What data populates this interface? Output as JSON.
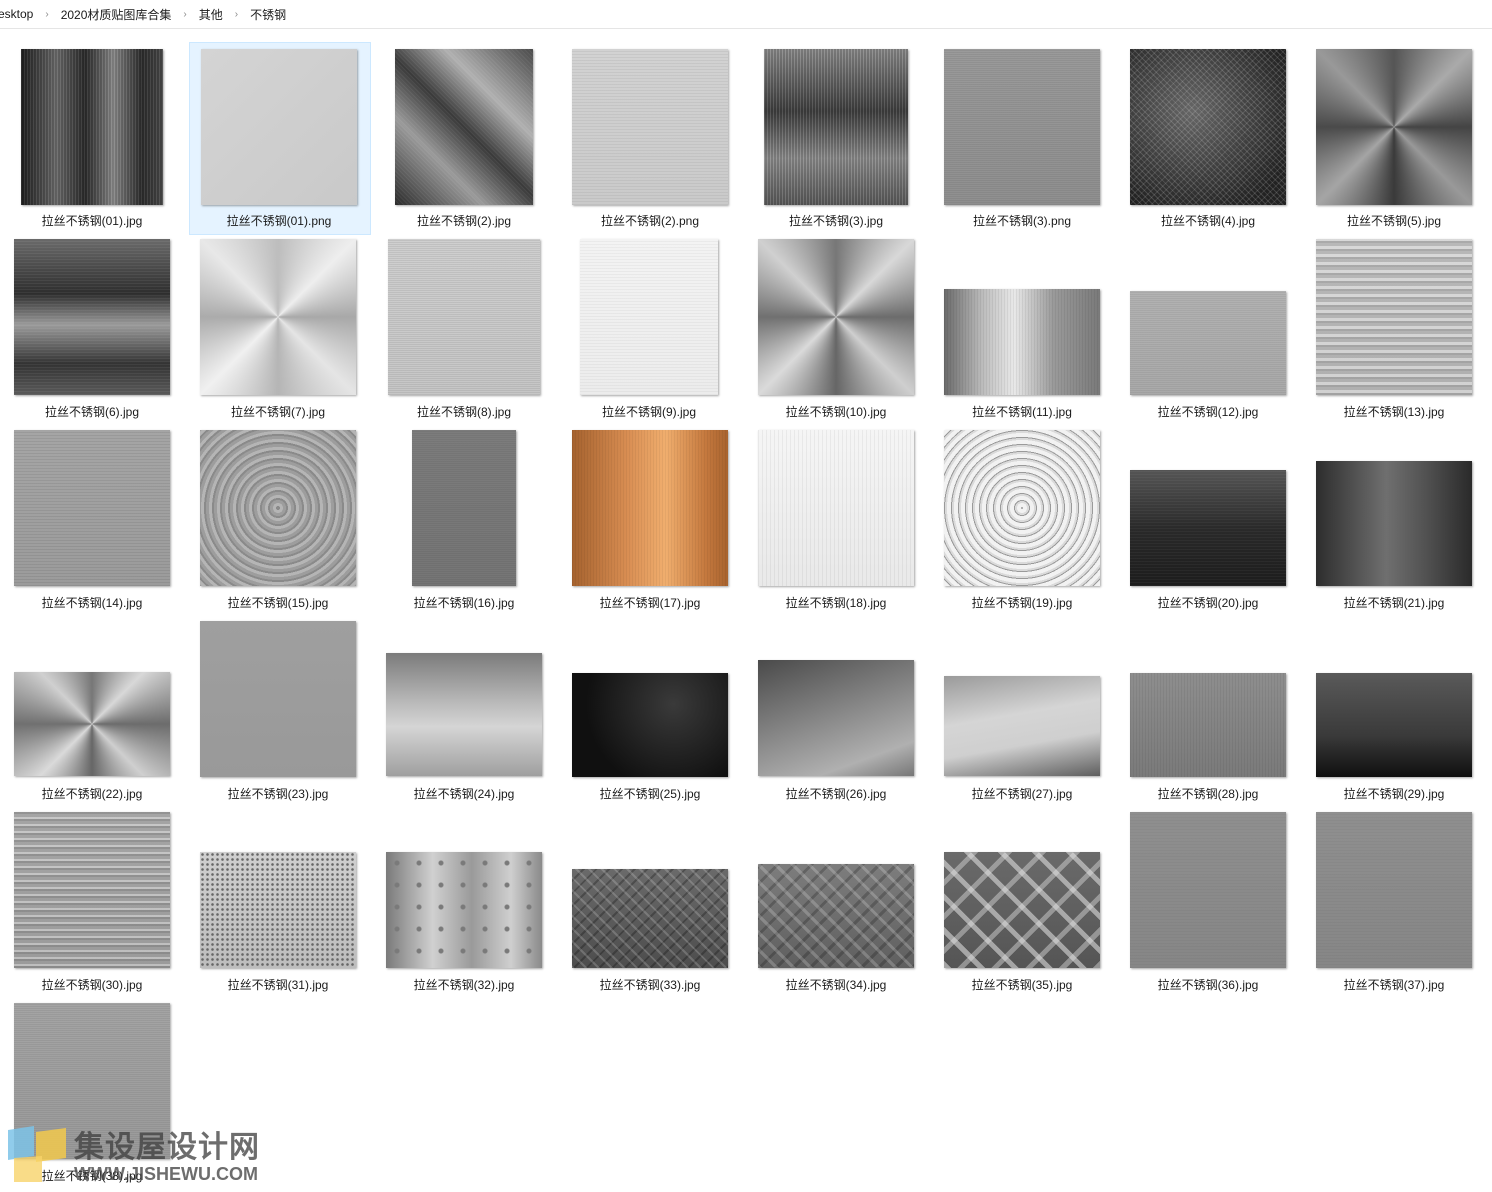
{
  "breadcrumb": [
    "esktop",
    "2020材质贴图库合集",
    "其他",
    "不锈钢"
  ],
  "files": [
    {
      "name": "拉丝不锈钢(01).jpg",
      "kind": "brushed-v-dark"
    },
    {
      "name": "拉丝不锈钢(01).png",
      "kind": "light-flat",
      "selected": true
    },
    {
      "name": "拉丝不锈钢(2).jpg",
      "kind": "brushed-diag-dark"
    },
    {
      "name": "拉丝不锈钢(2).png",
      "kind": "light-lines"
    },
    {
      "name": "拉丝不锈钢(3).jpg",
      "kind": "brushed-v-mid"
    },
    {
      "name": "拉丝不锈钢(3).png",
      "kind": "mid-grain"
    },
    {
      "name": "拉丝不锈钢(4).jpg",
      "kind": "dark-texture"
    },
    {
      "name": "拉丝不锈钢(5).jpg",
      "kind": "radial-dark"
    },
    {
      "name": "拉丝不锈钢(6).jpg",
      "kind": "brushed-h-dark"
    },
    {
      "name": "拉丝不锈钢(7).jpg",
      "kind": "radial-light"
    },
    {
      "name": "拉丝不锈钢(8).jpg",
      "kind": "light-grain"
    },
    {
      "name": "拉丝不锈钢(9).jpg",
      "kind": "white-lines"
    },
    {
      "name": "拉丝不锈钢(10).jpg",
      "kind": "radial-mid"
    },
    {
      "name": "拉丝不锈钢(11).jpg",
      "kind": "brushed-v-light"
    },
    {
      "name": "拉丝不锈钢(12).jpg",
      "kind": "mid-flat"
    },
    {
      "name": "拉丝不锈钢(13).jpg",
      "kind": "streak-light"
    },
    {
      "name": "拉丝不锈钢(14).jpg",
      "kind": "mid-lines"
    },
    {
      "name": "拉丝不锈钢(15).jpg",
      "kind": "rings-mid"
    },
    {
      "name": "拉丝不锈钢(16).jpg",
      "kind": "gray-flat"
    },
    {
      "name": "拉丝不锈钢(17).jpg",
      "kind": "copper"
    },
    {
      "name": "拉丝不锈钢(18).jpg",
      "kind": "white-grain"
    },
    {
      "name": "拉丝不锈钢(19).jpg",
      "kind": "rings-light"
    },
    {
      "name": "拉丝不锈钢(20).jpg",
      "kind": "dark-grad"
    },
    {
      "name": "拉丝不锈钢(21).jpg",
      "kind": "dark-v"
    },
    {
      "name": "拉丝不锈钢(22).jpg",
      "kind": "radial-mid"
    },
    {
      "name": "拉丝不锈钢(23).jpg",
      "kind": "gray-flat2"
    },
    {
      "name": "拉丝不锈钢(24).jpg",
      "kind": "silver-grad"
    },
    {
      "name": "拉丝不锈钢(25).jpg",
      "kind": "black"
    },
    {
      "name": "拉丝不锈钢(26).jpg",
      "kind": "dark-mid-grad"
    },
    {
      "name": "拉丝不锈钢(27).jpg",
      "kind": "silver-light-grad"
    },
    {
      "name": "拉丝不锈钢(28).jpg",
      "kind": "mid-v-lines"
    },
    {
      "name": "拉丝不锈钢(29).jpg",
      "kind": "dark-bottom"
    },
    {
      "name": "拉丝不锈钢(30).jpg",
      "kind": "streak-mid"
    },
    {
      "name": "拉丝不锈钢(31).jpg",
      "kind": "perforated"
    },
    {
      "name": "拉丝不锈钢(32).jpg",
      "kind": "plate-rivets"
    },
    {
      "name": "拉丝不锈钢(33).jpg",
      "kind": "diamond-dark"
    },
    {
      "name": "拉丝不锈钢(34).jpg",
      "kind": "diamond-mid"
    },
    {
      "name": "拉丝不锈钢(35).jpg",
      "kind": "tread-plate"
    },
    {
      "name": "拉丝不锈钢(36).jpg",
      "kind": "gray-flat3"
    },
    {
      "name": "拉丝不锈钢(37).jpg",
      "kind": "gray-flat3"
    },
    {
      "name": "拉丝不锈钢(38).jpg",
      "kind": "gray-grain"
    }
  ],
  "watermark": {
    "title": "集设屋设计网",
    "url": "WWW.JISHEWU.COM"
  }
}
